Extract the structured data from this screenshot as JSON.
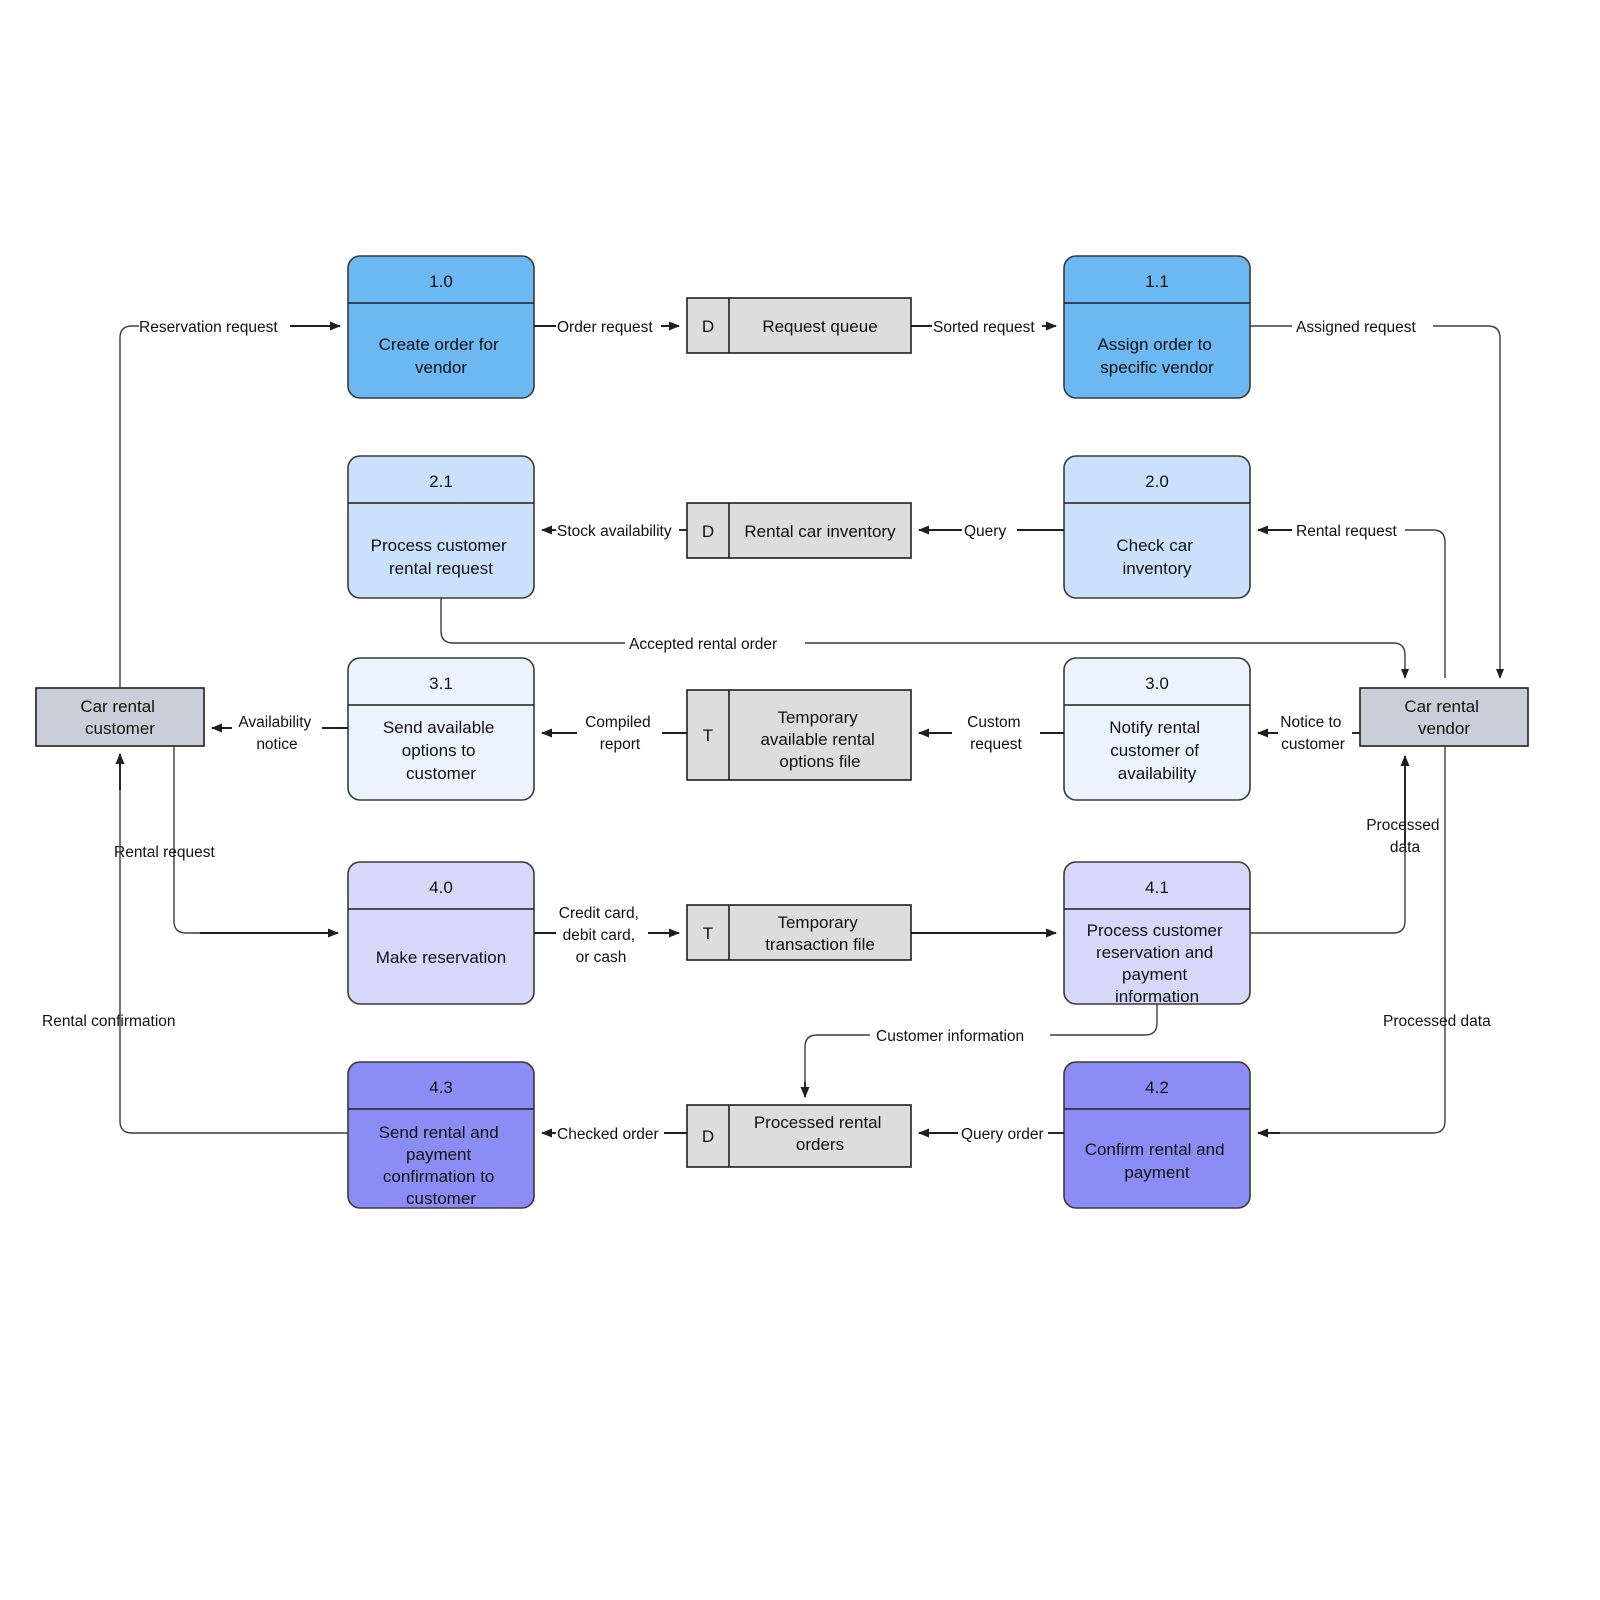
{
  "diagram": {
    "title": "Car rental data flow diagram",
    "colors": {
      "level1": "#6cb8f2",
      "level2": "#cbe0fb",
      "level3": "#ebf3fe",
      "level4a": "#d7d7f9",
      "level4b": "#8c8cf5",
      "store": "#dddddd",
      "external": "#c9ced8",
      "stroke": "#1f1f1f"
    },
    "processes": [
      {
        "id": "p10",
        "number": "1.0",
        "label": "Create order for vendor",
        "fill": "#6cb8f2"
      },
      {
        "id": "p11",
        "number": "1.1",
        "label": "Assign order to specific vendor",
        "fill": "#6cb8f2"
      },
      {
        "id": "p21",
        "number": "2.1",
        "label": "Process customer rental request",
        "fill": "#cbe0fb"
      },
      {
        "id": "p20",
        "number": "2.0",
        "label": "Check car inventory",
        "fill": "#cbe0fb"
      },
      {
        "id": "p31",
        "number": "3.1",
        "label": "Send available options to customer",
        "fill": "#ebf3fe"
      },
      {
        "id": "p30",
        "number": "3.0",
        "label": "Notify rental customer of availability",
        "fill": "#ebf3fe"
      },
      {
        "id": "p40",
        "number": "4.0",
        "label": "Make reservation",
        "fill": "#d7d7f9"
      },
      {
        "id": "p41",
        "number": "4.1",
        "label": "Process customer reservation and payment information",
        "fill": "#d7d7f9"
      },
      {
        "id": "p43",
        "number": "4.3",
        "label": "Send rental and payment confirmation to customer",
        "fill": "#8c8cf5"
      },
      {
        "id": "p42",
        "number": "4.2",
        "label": "Confirm rental and payment",
        "fill": "#8c8cf5"
      }
    ],
    "process_lines": {
      "p10": [
        "Create order for",
        "vendor"
      ],
      "p11": [
        "Assign order to",
        "specific vendor"
      ],
      "p21": [
        "Process customer",
        "rental request"
      ],
      "p20": [
        "Check car",
        "inventory"
      ],
      "p31": [
        "Send available",
        "options to",
        "customer"
      ],
      "p30": [
        "Notify rental",
        "customer of",
        "availability"
      ],
      "p40": [
        "Make reservation"
      ],
      "p41": [
        "Process customer",
        "reservation and",
        "payment",
        "information"
      ],
      "p43": [
        "Send rental and",
        "payment",
        "confirmation to",
        "customer"
      ],
      "p42": [
        "Confirm rental and",
        "payment"
      ]
    },
    "data_stores": [
      {
        "id": "d1",
        "code": "D",
        "label": "Request queue",
        "lines": [
          "Request queue"
        ]
      },
      {
        "id": "d2",
        "code": "D",
        "label": "Rental car inventory",
        "lines": [
          "Rental car inventory"
        ]
      },
      {
        "id": "t1",
        "code": "T",
        "label": "Temporary available rental options file",
        "lines": [
          "Temporary",
          "available rental",
          "options file"
        ]
      },
      {
        "id": "t2",
        "code": "T",
        "label": "Temporary transaction file",
        "lines": [
          "Temporary",
          "transaction file"
        ]
      },
      {
        "id": "d3",
        "code": "D",
        "label": "Processed rental orders",
        "lines": [
          "Processed rental",
          "orders"
        ]
      }
    ],
    "external_entities": [
      {
        "id": "e_cust",
        "label": "Car rental customer",
        "lines": [
          "Car rental",
          "customer"
        ]
      },
      {
        "id": "e_vend",
        "label": "Car rental vendor",
        "lines": [
          "Car rental",
          "vendor"
        ]
      }
    ],
    "flows": [
      {
        "id": "f1",
        "label": "Reservation request",
        "lines": [
          "Reservation request"
        ]
      },
      {
        "id": "f2",
        "label": "Order request",
        "lines": [
          "Order request"
        ]
      },
      {
        "id": "f3",
        "label": "Sorted request",
        "lines": [
          "Sorted request"
        ]
      },
      {
        "id": "f4",
        "label": "Assigned request",
        "lines": [
          "Assigned request"
        ]
      },
      {
        "id": "f5",
        "label": "Stock availability",
        "lines": [
          "Stock availability"
        ]
      },
      {
        "id": "f6",
        "label": "Query",
        "lines": [
          "Query"
        ]
      },
      {
        "id": "f7",
        "label": "Rental request",
        "lines": [
          "Rental request"
        ]
      },
      {
        "id": "f8",
        "label": "Accepted rental order",
        "lines": [
          "Accepted rental order"
        ]
      },
      {
        "id": "f9",
        "label": "Availability notice",
        "lines": [
          "Availability",
          "notice"
        ]
      },
      {
        "id": "f10",
        "label": "Compiled report",
        "lines": [
          "Compiled",
          "report"
        ]
      },
      {
        "id": "f11",
        "label": "Custom request",
        "lines": [
          "Custom",
          "request"
        ]
      },
      {
        "id": "f12",
        "label": "Notice to customer",
        "lines": [
          "Notice to",
          "customer"
        ]
      },
      {
        "id": "f13",
        "label": "Rental request",
        "lines": [
          "Rental request"
        ]
      },
      {
        "id": "f14",
        "label": "Credit card, debit card, or cash",
        "lines": [
          "Credit card,",
          "debit card,",
          "or cash"
        ]
      },
      {
        "id": "f15",
        "label": "Processed data",
        "lines": [
          "Processed",
          "data"
        ]
      },
      {
        "id": "f16",
        "label": "Customer information",
        "lines": [
          "Customer information"
        ]
      },
      {
        "id": "f17",
        "label": "Processed data",
        "lines": [
          "Processed data"
        ]
      },
      {
        "id": "f18",
        "label": "Query order",
        "lines": [
          "Query order"
        ]
      },
      {
        "id": "f19",
        "label": "Checked order",
        "lines": [
          "Checked order"
        ]
      },
      {
        "id": "f20",
        "label": "Rental confirmation",
        "lines": [
          "Rental confirmation"
        ]
      }
    ]
  }
}
